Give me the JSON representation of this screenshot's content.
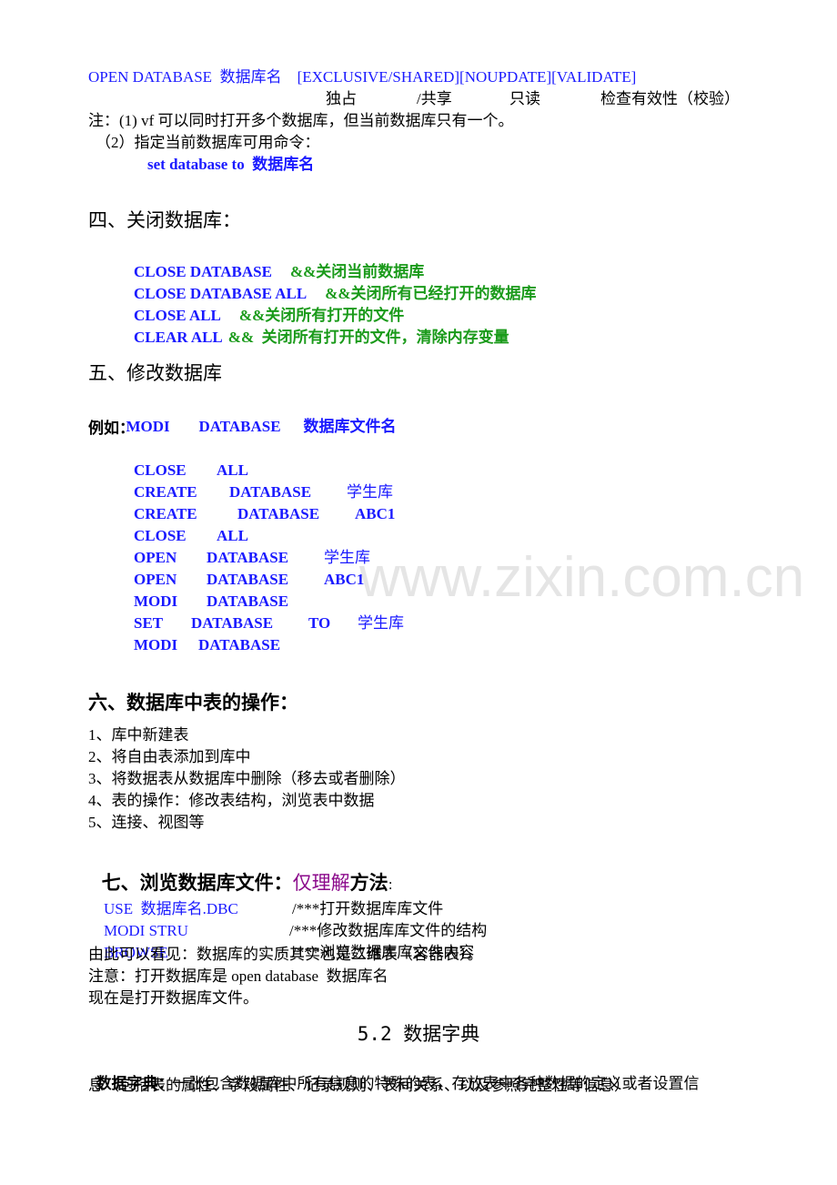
{
  "open_syntax": {
    "command": "OPEN DATABASE  数据库名    [EXCLUSIVE/SHARED][NOUPDATE][VALIDATE]",
    "annotations": [
      "独占",
      "/共享",
      "只读",
      "检查有效性（校验）"
    ],
    "note1": "注：(1) vf 可以同时打开多个数据库，但当前数据库只有一个。",
    "note2": "（2）指定当前数据库可用命令：",
    "set_cmd": "set database to  数据库名"
  },
  "section4": {
    "title": "四、关闭数据库：",
    "commands": [
      {
        "cmd": "CLOSE DATABASE",
        "comment": "&&关闭当前数据库"
      },
      {
        "cmd": "CLOSE DATABASE ALL",
        "comment": "&&关闭所有已经打开的数据库"
      },
      {
        "cmd": "CLOSE ALL",
        "comment": "&&关闭所有打开的文件"
      },
      {
        "cmd": "CLEAR ALL",
        "comment": "&&  关闭所有打开的文件，清除内存变量"
      }
    ]
  },
  "section5": {
    "title": "五、修改数据库",
    "syntax": [
      "MODI",
      "DATABASE",
      "数据库文件名"
    ],
    "example_label": "例如：",
    "examples": [
      [
        "CLOSE",
        "ALL"
      ],
      [
        "CREATE",
        "DATABASE",
        "学生库"
      ],
      [
        "CREATE",
        "DATABASE",
        "ABC1"
      ],
      [
        "CLOSE",
        "ALL"
      ],
      [
        "OPEN",
        "DATABASE",
        "学生库"
      ],
      [
        "OPEN",
        "DATABASE",
        "ABC1"
      ],
      [
        "MODI",
        "DATABASE"
      ],
      [
        "SET",
        "DATABASE",
        "TO",
        "学生库"
      ],
      [
        "MODI",
        "DATABASE"
      ]
    ]
  },
  "watermark": "www.zixin.com.cn",
  "section6": {
    "title": "六、数据库中表的操作：",
    "items": [
      "1、库中新建表",
      "2、将自由表添加到库中",
      "3、将数据表从数据库中删除（移去或者删除）",
      "4、表的操作：修改表结构，浏览表中数据",
      "5、连接、视图等"
    ]
  },
  "section7": {
    "title_prefix": "七、浏览数据库文件：",
    "title_highlight": "仅理解",
    "title_suffix": "方法",
    "title_colon": ":",
    "commands": [
      {
        "cmd": "USE  数据库名.DBC",
        "comment": "/***打开数据库库文件"
      },
      {
        "cmd": "MODI STRU",
        "comment": "/***修改数据库库文件的结构"
      },
      {
        "cmd": "BROWSE",
        "comment": "/***浏览数据库库文件内容"
      }
    ],
    "lines": [
      "由此可以看见：数据库的实质其实也是二维表（容器表）。",
      "注意：打开数据库是 open database  数据库名",
      "现在是打开数据库文件。"
    ]
  },
  "section52": {
    "title": "5.2 数据字典",
    "term": "数据字典",
    "colon": "：",
    "definition_line1": "一张包含数据库中所有信息的特殊的表，存放表中各种数据的定义或者设置信",
    "definition_line2": "息（包括表的属性、字段属性、记录规则、表间关系、以及参照完整性等信息）"
  },
  "colors": {
    "command_blue": "#1a1aff",
    "comment_green": "#1a9a1a",
    "highlight_purple": "#8b0a8b"
  }
}
